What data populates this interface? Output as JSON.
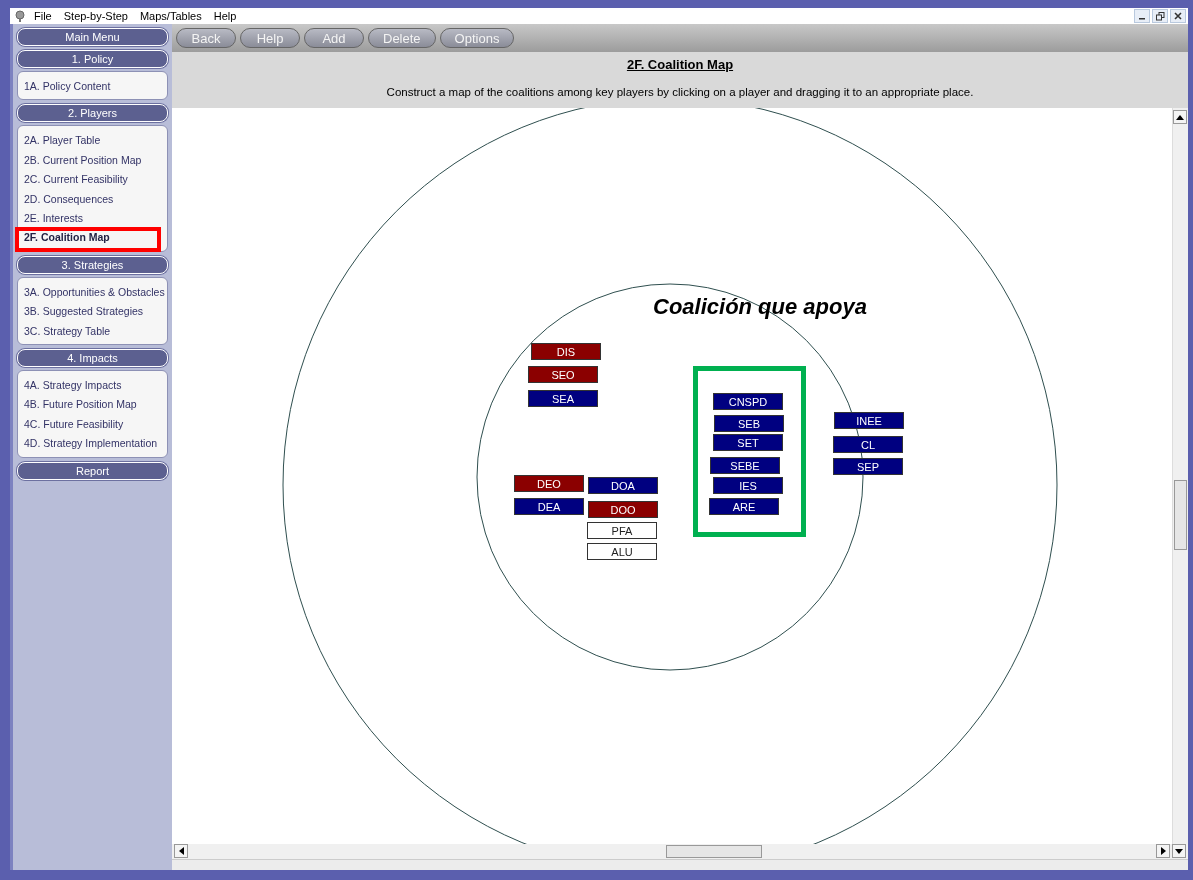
{
  "menu_bar": {
    "items": [
      "File",
      "Step-by-Step",
      "Maps/Tables",
      "Help"
    ]
  },
  "sidebar": {
    "sections": [
      {
        "title": "Main Menu"
      },
      {
        "title": "1. Policy",
        "items": [
          {
            "label": "1A. Policy Content",
            "selected": false,
            "highlighted": false
          }
        ]
      },
      {
        "title": "2. Players",
        "items": [
          {
            "label": "2A. Player Table",
            "selected": false,
            "highlighted": false
          },
          {
            "label": "2B. Current Position Map",
            "selected": false,
            "highlighted": false
          },
          {
            "label": "2C. Current Feasibility",
            "selected": false,
            "highlighted": false
          },
          {
            "label": "2D. Consequences",
            "selected": false,
            "highlighted": false
          },
          {
            "label": "2E. Interests",
            "selected": false,
            "highlighted": false
          },
          {
            "label": "2F. Coalition Map",
            "selected": true,
            "highlighted": true
          }
        ]
      },
      {
        "title": "3. Strategies",
        "items": [
          {
            "label": "3A. Opportunities & Obstacles",
            "selected": false,
            "highlighted": false
          },
          {
            "label": "3B. Suggested Strategies",
            "selected": false,
            "highlighted": false
          },
          {
            "label": "3C. Strategy Table",
            "selected": false,
            "highlighted": false
          }
        ]
      },
      {
        "title": "4. Impacts",
        "items": [
          {
            "label": "4A. Strategy Impacts",
            "selected": false,
            "highlighted": false
          },
          {
            "label": "4B. Future Position Map",
            "selected": false,
            "highlighted": false
          },
          {
            "label": "4C. Future Feasibility",
            "selected": false,
            "highlighted": false
          },
          {
            "label": "4D. Strategy Implementation",
            "selected": false,
            "highlighted": false
          }
        ]
      },
      {
        "title": "Report"
      }
    ]
  },
  "toolbar": {
    "buttons": [
      "Back",
      "Help",
      "Add",
      "Delete",
      "Options"
    ]
  },
  "page": {
    "title": "2F. Coalition Map",
    "instructions": "Construct a map of the coalitions among key players by clicking on a player and dragging it to an appropriate place."
  },
  "coalition_map": {
    "annotation": "Coalición que apoya",
    "players": [
      {
        "name": "DIS",
        "color": "#8b0000"
      },
      {
        "name": "SEO",
        "color": "#8b0000"
      },
      {
        "name": "SEA",
        "color": "#000080"
      },
      {
        "name": "DEO",
        "color": "#8b0000"
      },
      {
        "name": "DEA",
        "color": "#000080"
      },
      {
        "name": "DOA",
        "color": "#000080"
      },
      {
        "name": "DOO",
        "color": "#8b0000"
      },
      {
        "name": "PFA",
        "color": "#ffffff"
      },
      {
        "name": "ALU",
        "color": "#ffffff"
      },
      {
        "name": "CNSPD",
        "color": "#000080"
      },
      {
        "name": "SEB",
        "color": "#000080"
      },
      {
        "name": "SET",
        "color": "#000080"
      },
      {
        "name": "SEBE",
        "color": "#000080"
      },
      {
        "name": "IES",
        "color": "#000080"
      },
      {
        "name": "ARE",
        "color": "#000080"
      },
      {
        "name": "INEE",
        "color": "#000080"
      },
      {
        "name": "CL",
        "color": "#000080"
      },
      {
        "name": "SEP",
        "color": "#000080"
      }
    ]
  }
}
